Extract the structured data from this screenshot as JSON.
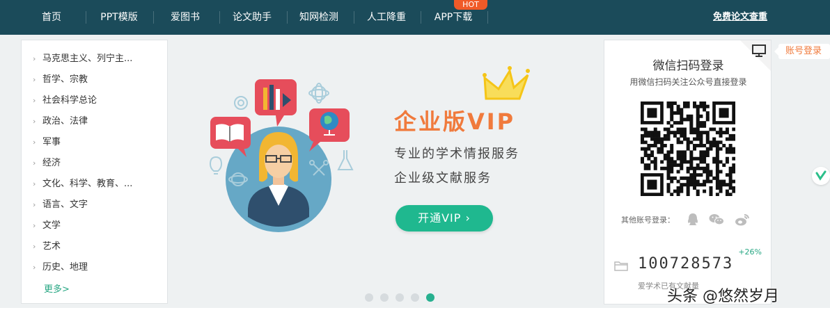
{
  "nav": {
    "items": [
      "首页",
      "PPT模版",
      "爱图书",
      "论文助手",
      "知网检测",
      "人工降重",
      "APP下载"
    ],
    "hot_badge": "HOT",
    "right_link": "免费论文查重",
    "bg_color": "#1b4b5a"
  },
  "categories": {
    "items": [
      "马克思主义、列宁主...",
      "哲学、宗教",
      "社会科学总论",
      "政治、法律",
      "军事",
      "经济",
      "文化、科学、教育、...",
      "语言、文字",
      "文学",
      "艺术",
      "历史、地理"
    ],
    "more": "更多>"
  },
  "banner": {
    "title": "企业版VIP",
    "line1": "专业的学术情报服务",
    "line2": "企业级文献服务",
    "button": "开通VIP  ›",
    "slides": 5,
    "active_slide": 5,
    "accent_color": "#1fb88f",
    "title_color": "#f07a3c"
  },
  "login": {
    "title": "微信扫码登录",
    "subtitle": "用微信扫码关注公众号直接登录",
    "other_label": "其他账号登录：",
    "social_icons": [
      "qq-icon",
      "wechat-icon",
      "weibo-icon"
    ],
    "count": "100728573",
    "count_pct": "+26%",
    "count_label": "爱学术已有文献量",
    "account_tab": "账号登录"
  },
  "watermark": "头条 @悠然岁月"
}
